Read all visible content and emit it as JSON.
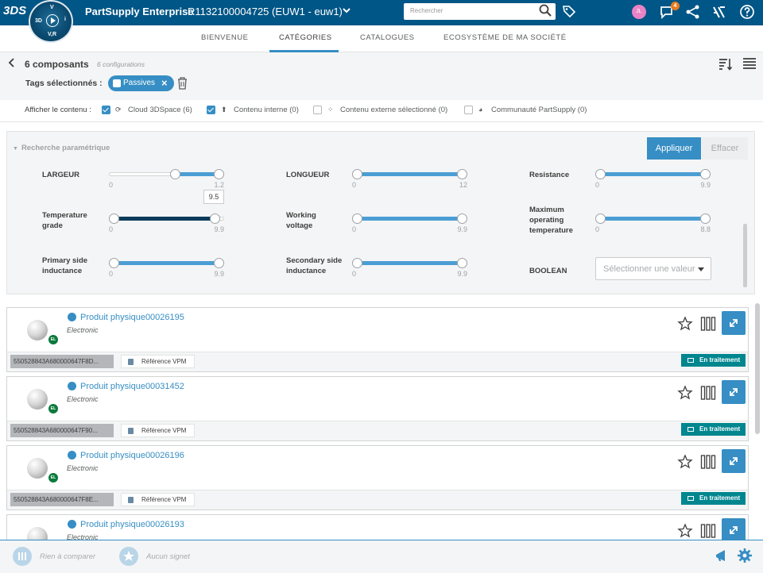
{
  "topbar": {
    "brand_mark": "3DS",
    "compass": {
      "top_label": "3D",
      "north": "V",
      "right": "i",
      "bottom": "V,R"
    },
    "app_title": "PartSupply Enterprise",
    "tenant": "R1132100004725 (EUW1 - euw1)",
    "search_placeholder": "Rechercher",
    "avatar_initials": "JL",
    "notification_count": "4",
    "brand_color": "#005686",
    "icons": [
      "search-icon",
      "tag-icon",
      "notification-icon",
      "share-icon",
      "apps-icon",
      "help-icon"
    ]
  },
  "tabs": [
    {
      "label": "Bienvenue"
    },
    {
      "label": "Catégories",
      "active": true
    },
    {
      "label": "Catalogues"
    },
    {
      "label": "Ecosystème de ma société"
    }
  ],
  "header": {
    "title": "6 composants",
    "subtitle": "6 configurations",
    "tags_label": "Tags sélectionnés :",
    "tag": "Passives"
  },
  "filters": {
    "label": "Afficher le contenu :",
    "options": [
      {
        "label": "Cloud 3DSpace (6)",
        "checked": true
      },
      {
        "label": "Contenu interne (0)",
        "checked": true
      },
      {
        "label": "Contenu externe sélectionné (0)",
        "checked": false
      },
      {
        "label": "Communauté PartSupply (0)",
        "checked": false
      }
    ]
  },
  "param_search": {
    "title": "Recherche paramétrique",
    "apply_label": "Appliquer",
    "clear_label": "Effacer",
    "sliders": [
      {
        "label": "LARGEUR",
        "min": "0",
        "max": "1.2",
        "low": 0.7,
        "high": 1.2
      },
      {
        "label": "LONGUEUR",
        "min": "0",
        "max": "12",
        "low": 0,
        "high": 12
      },
      {
        "label": "Resistance",
        "min": "0",
        "max": "9.9",
        "low": 0,
        "high": 9.9
      },
      {
        "label": "Temperature grade",
        "min": "0",
        "max": "9.9",
        "low": 0,
        "high": 9.5,
        "tooltip": "9.5"
      },
      {
        "label": "Working voltage",
        "min": "0",
        "max": "9.9",
        "low": 0,
        "high": 9.9
      },
      {
        "label": "Maximum operating temperature",
        "min": "0",
        "max": "8.8",
        "low": 0,
        "high": 8.8
      },
      {
        "label": "Primary side inductance",
        "min": "0",
        "max": "9.9",
        "low": 0,
        "high": 9.9
      },
      {
        "label": "Secondary side inductance",
        "min": "0",
        "max": "9.9",
        "low": 0,
        "high": 9.9
      }
    ],
    "boolean_label": "BOOLEAN",
    "boolean_placeholder": "Sélectionner une valeur"
  },
  "products": [
    {
      "name": "Produit physique00026195",
      "type": "Electronic",
      "id": "550528843A680000647F8D...",
      "ref": "Référence VPM",
      "status": "En traitement",
      "badge": "EL"
    },
    {
      "name": "Produit physique00031452",
      "type": "Electronic",
      "id": "550528843A680000647F90...",
      "ref": "Référence VPM",
      "status": "En traitement",
      "badge": "EL"
    },
    {
      "name": "Produit physique00026196",
      "type": "Electronic",
      "id": "550528843A680000647F8E...",
      "ref": "Référence VPM",
      "status": "En traitement",
      "badge": "EL"
    },
    {
      "name": "Produit physique00026193",
      "type": "Electronic",
      "id": "",
      "ref": "",
      "status": "",
      "badge": ""
    }
  ],
  "footer": {
    "compare_label": "Rien à comparer",
    "bookmark_label": "Aucun signet"
  }
}
